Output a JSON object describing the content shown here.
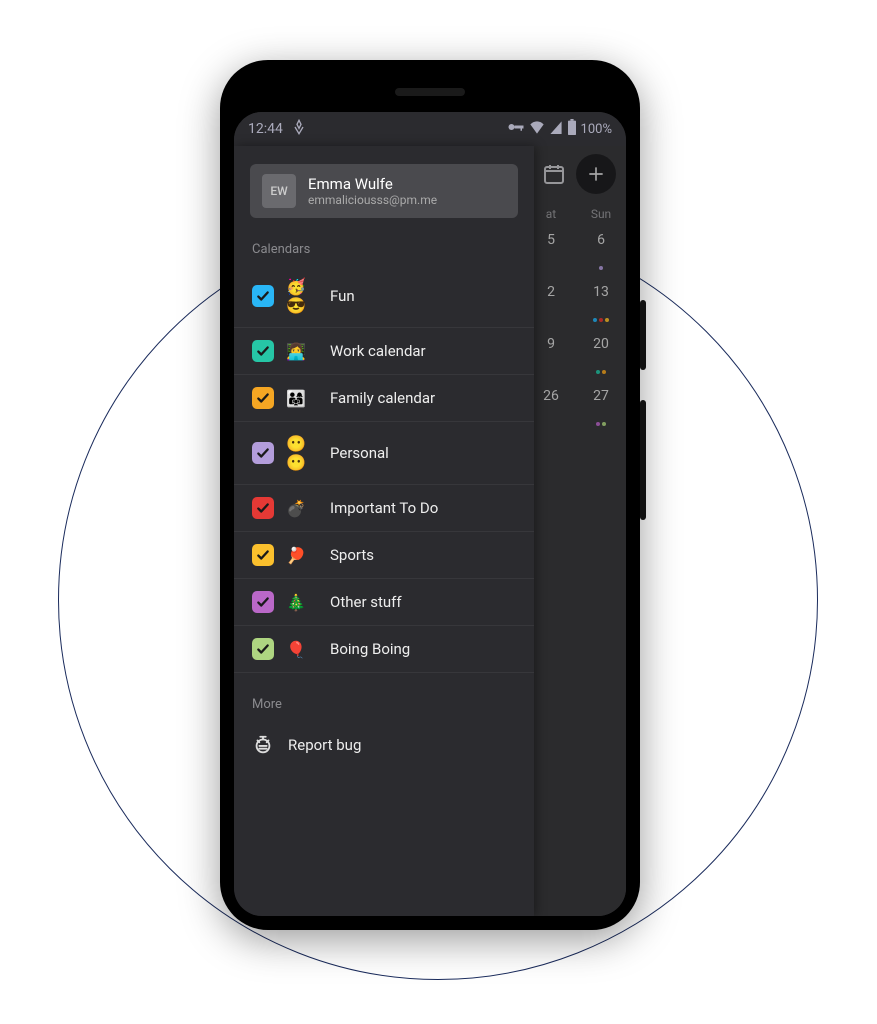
{
  "status_bar": {
    "time": "12:44",
    "battery_text": "100%"
  },
  "drawer": {
    "account": {
      "initials": "EW",
      "name": "Emma Wulfe",
      "email": "emmaliciousss@pm.me"
    },
    "calendars_label": "Calendars",
    "calendars": [
      {
        "color": "#29b6f6",
        "emoji": "🥳😎",
        "name": "Fun",
        "checked": true
      },
      {
        "color": "#26c6a6",
        "emoji": "👩‍💻",
        "name": "Work calendar",
        "checked": true
      },
      {
        "color": "#f5a623",
        "emoji": "👨‍👩‍👧",
        "name": "Family calendar",
        "checked": true
      },
      {
        "color": "#b39ddb",
        "emoji": "😶😶",
        "name": "Personal",
        "checked": true
      },
      {
        "color": "#e53935",
        "emoji": "💣",
        "name": "Important To Do",
        "checked": true
      },
      {
        "color": "#fbc02d",
        "emoji": "🏓",
        "name": "Sports",
        "checked": true
      },
      {
        "color": "#ba68c8",
        "emoji": "🎄",
        "name": "Other stuff",
        "checked": true
      },
      {
        "color": "#aed581",
        "emoji": "🎈",
        "name": "Boing Boing",
        "checked": true
      }
    ],
    "more_label": "More",
    "more_items": [
      {
        "icon": "bug-icon",
        "label": "Report bug"
      }
    ]
  },
  "calendar_peek": {
    "day_headers": [
      "at",
      "Sun"
    ],
    "rows": [
      {
        "left": "5",
        "right": "6",
        "right_dots": [
          "#b39ddb"
        ]
      },
      {
        "left": "2",
        "right": "13",
        "right_dots": [
          "#29b6f6",
          "#e53935",
          "#fbc02d"
        ]
      },
      {
        "left": "9",
        "right": "20",
        "right_dots": [
          "#26c6a6",
          "#f5a623"
        ]
      },
      {
        "left": "26",
        "right": "27",
        "right_dots": [
          "#ba68c8",
          "#aed581"
        ]
      }
    ]
  }
}
